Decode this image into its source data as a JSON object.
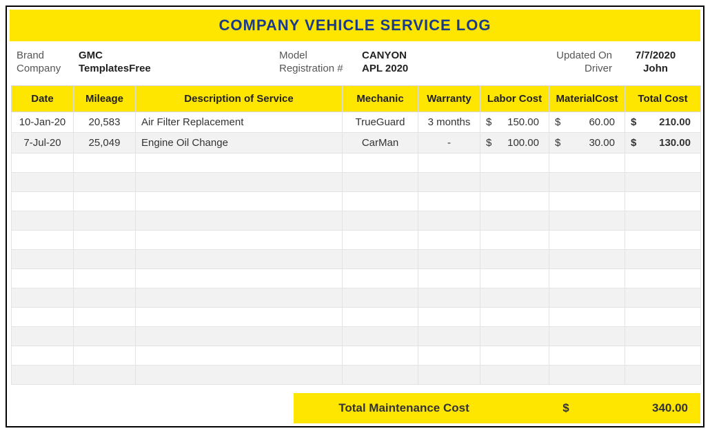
{
  "title": "COMPANY VEHICLE SERVICE LOG",
  "info": {
    "brand_label": "Brand",
    "brand_value": "GMC",
    "company_label": "Company",
    "company_value": "TemplatesFree",
    "model_label": "Model",
    "model_value": "CANYON",
    "registration_label": "Registration #",
    "registration_value": "APL 2020",
    "updated_label": "Updated On",
    "updated_value": "7/7/2020",
    "driver_label": "Driver",
    "driver_value": "John"
  },
  "columns": {
    "date": "Date",
    "mileage": "Mileage",
    "description": "Description of Service",
    "mechanic": "Mechanic",
    "warranty": "Warranty",
    "labor": "Labor Cost",
    "material": "MaterialCost",
    "total": "Total Cost"
  },
  "rows": [
    {
      "date": "10-Jan-20",
      "mileage": "20,583",
      "description": "Air Filter Replacement",
      "mechanic": "TrueGuard",
      "warranty": "3 months",
      "labor_sym": "$",
      "labor": "150.00",
      "material_sym": "$",
      "material": "60.00",
      "total_sym": "$",
      "total": "210.00"
    },
    {
      "date": "7-Jul-20",
      "mileage": "25,049",
      "description": "Engine Oil Change",
      "mechanic": "CarMan",
      "warranty": "-",
      "labor_sym": "$",
      "labor": "100.00",
      "material_sym": "$",
      "material": "30.00",
      "total_sym": "$",
      "total": "130.00"
    }
  ],
  "footer": {
    "label": "Total Maintenance Cost",
    "sym": "$",
    "value": "340.00"
  }
}
